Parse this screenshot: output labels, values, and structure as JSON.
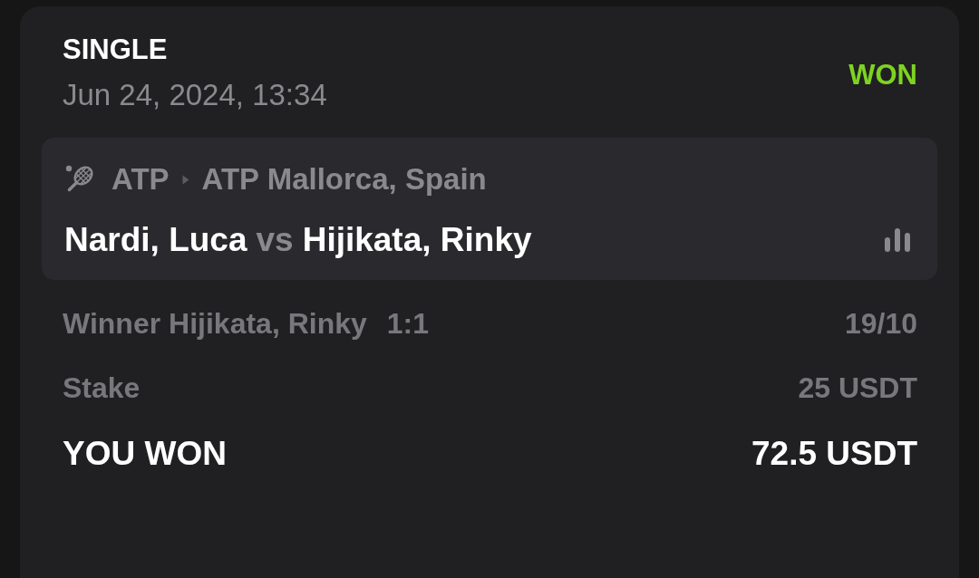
{
  "bet": {
    "type": "SINGLE",
    "date": "Jun 24, 2024, 13:34",
    "status": {
      "label": "WON",
      "kind": "won"
    }
  },
  "event": {
    "category": "ATP",
    "tournament": "ATP Mallorca, Spain",
    "home": "Nardi, Luca",
    "separator": "vs",
    "away": "Hijikata, Rinky"
  },
  "selection": {
    "market": "Winner Hijikata, Rinky",
    "score": "1:1",
    "odds": "19/10"
  },
  "stake": {
    "label": "Stake",
    "value": "25 USDT"
  },
  "payout": {
    "label": "YOU WON",
    "value": "72.5 USDT"
  }
}
